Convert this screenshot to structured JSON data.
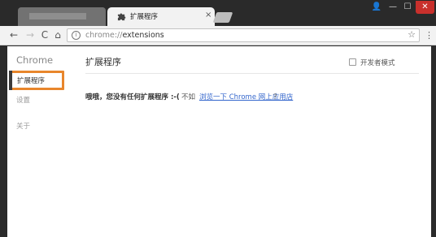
{
  "tabs": [
    {
      "label": ""
    },
    {
      "label": "扩展程序",
      "close": "×"
    }
  ],
  "window_controls": {
    "user": "👤",
    "minimize": "—",
    "maximize": "☐",
    "close": "✕"
  },
  "toolbar": {
    "back": "←",
    "forward": "→",
    "reload": "C",
    "home": "⌂",
    "url_scheme": "chrome://",
    "url_path": "extensions",
    "star": "☆",
    "menu": "⋮"
  },
  "sidebar": {
    "title": "Chrome",
    "items": [
      {
        "label": "扩展程序",
        "selected": true
      },
      {
        "label": "设置"
      },
      {
        "label": "关于"
      }
    ]
  },
  "main": {
    "title": "扩展程序",
    "dev_mode_label": "开发者模式",
    "empty_message": "哦哦，您没有任何扩展程序 :-(",
    "prefix": "不如",
    "link": "浏览一下 Chrome 网上应用店",
    "suffix": "？"
  },
  "colors": {
    "highlight_border": "#e8862c",
    "link": "#3366cc",
    "close_button": "#c9302c"
  }
}
